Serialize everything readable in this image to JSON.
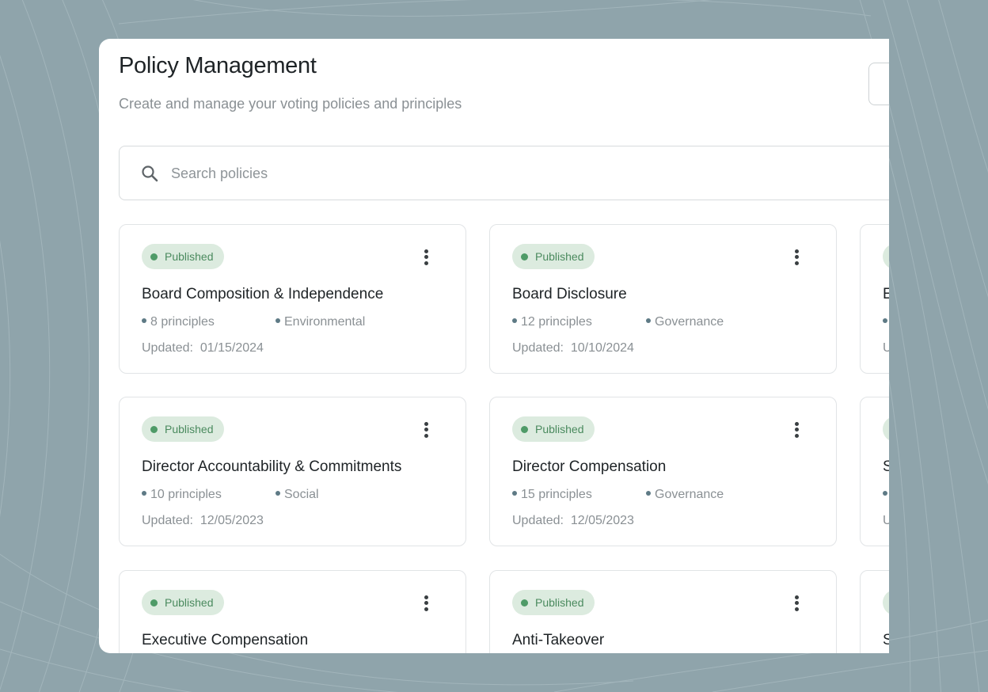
{
  "header": {
    "title": "Policy Management",
    "subtitle": "Create and manage your voting policies and principles"
  },
  "search": {
    "placeholder": "Search policies",
    "icon": "search-icon"
  },
  "colors": {
    "background": "#8fa4ab",
    "badge_bg": "#dcebdf",
    "badge_accent": "#4f9b68"
  },
  "cards": [
    {
      "status": "Published",
      "title": "Board Composition & Independence",
      "principles": "8 principles",
      "category": "Environmental",
      "updated_label": "Updated:",
      "updated": "01/15/2024"
    },
    {
      "status": "Published",
      "title": "Board Disclosure",
      "principles": "12 principles",
      "category": "Governance",
      "updated_label": "Updated:",
      "updated": "10/10/2024"
    },
    {
      "status": "Published",
      "title": "Director Accountability & Commitments",
      "principles": "10 principles",
      "category": "Social",
      "updated_label": "Updated:",
      "updated": "12/05/2023"
    },
    {
      "status": "Published",
      "title": "Director Compensation",
      "principles": "15 principles",
      "category": "Governance",
      "updated_label": "Updated:",
      "updated": "12/05/2023"
    },
    {
      "status": "Published",
      "title": "Executive Compensation",
      "principles": "",
      "category": "",
      "updated_label": "",
      "updated": ""
    },
    {
      "status": "Published",
      "title": "Anti-Takeover",
      "principles": "",
      "category": "",
      "updated_label": "",
      "updated": ""
    }
  ],
  "partial_cards": [
    {
      "title_initial": "E",
      "updated_initial": "U"
    },
    {
      "title_initial": "S",
      "updated_initial": "U"
    },
    {
      "title_initial": "S",
      "updated_initial": ""
    }
  ]
}
